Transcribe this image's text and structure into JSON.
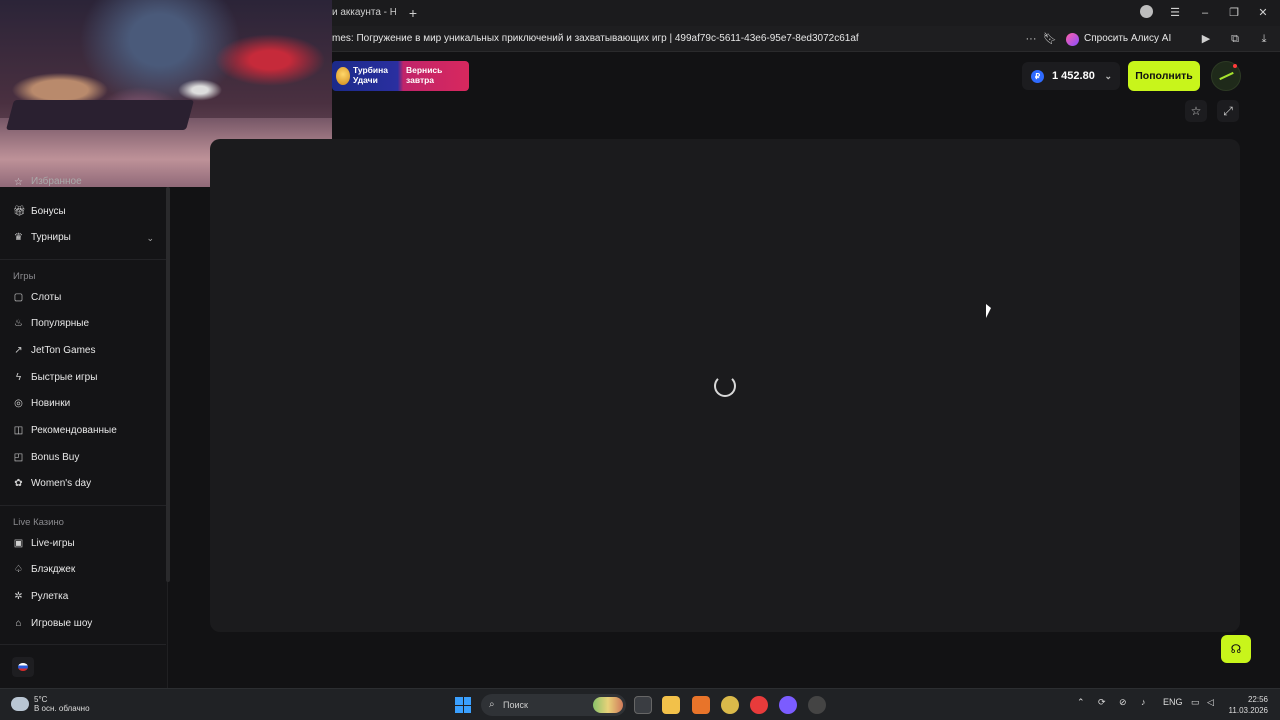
{
  "browser": {
    "tab_title": "и аккаунта - На",
    "new_tab": "+",
    "url": "mes: Погружение в мир уникальных приключений и захватывающих игр | 499af79c-5611-43e6-95e7-8ed3072c61af",
    "alice_label": "Спросить Алису AI",
    "more": "···"
  },
  "promo": {
    "left_text": "Турбина Удачи",
    "right_text": "Вернись завтра"
  },
  "header": {
    "currency_symbol": "₽",
    "balance": "1 452.80",
    "deposit_label": "Пополнить"
  },
  "sidebar": {
    "top_items": [
      {
        "label": "Избранное",
        "icon": "star-icon"
      },
      {
        "label": "Бонусы",
        "icon": "gift-icon"
      },
      {
        "label": "Турниры",
        "icon": "trophy-icon"
      }
    ],
    "games_heading": "Игры",
    "games": [
      {
        "label": "Слоты",
        "icon": "slots-icon"
      },
      {
        "label": "Популярные",
        "icon": "fire-icon"
      },
      {
        "label": "JetTon Games",
        "icon": "jetton-icon"
      },
      {
        "label": "Быстрые игры",
        "icon": "lightning-icon"
      },
      {
        "label": "Новинки",
        "icon": "new-icon"
      },
      {
        "label": "Рекомендованные",
        "icon": "recommended-icon"
      },
      {
        "label": "Bonus Buy",
        "icon": "bag-icon"
      },
      {
        "label": "Women's day",
        "icon": "flower-icon"
      }
    ],
    "live_heading": "Live Казино",
    "live": [
      {
        "label": "Live-игры",
        "icon": "live-icon"
      },
      {
        "label": "Блэкджек",
        "icon": "spade-icon"
      },
      {
        "label": "Рулетка",
        "icon": "roulette-icon"
      },
      {
        "label": "Игровые шоу",
        "icon": "show-icon"
      }
    ]
  },
  "taskbar": {
    "temperature": "5°C",
    "weather": "В осн. облачно",
    "search_placeholder": "Поиск",
    "language": "ENG",
    "time": "22:56",
    "date": "11.03.2026"
  },
  "colors": {
    "accent": "#c8f51b",
    "background": "#121214",
    "panel": "#1b1b1d"
  }
}
